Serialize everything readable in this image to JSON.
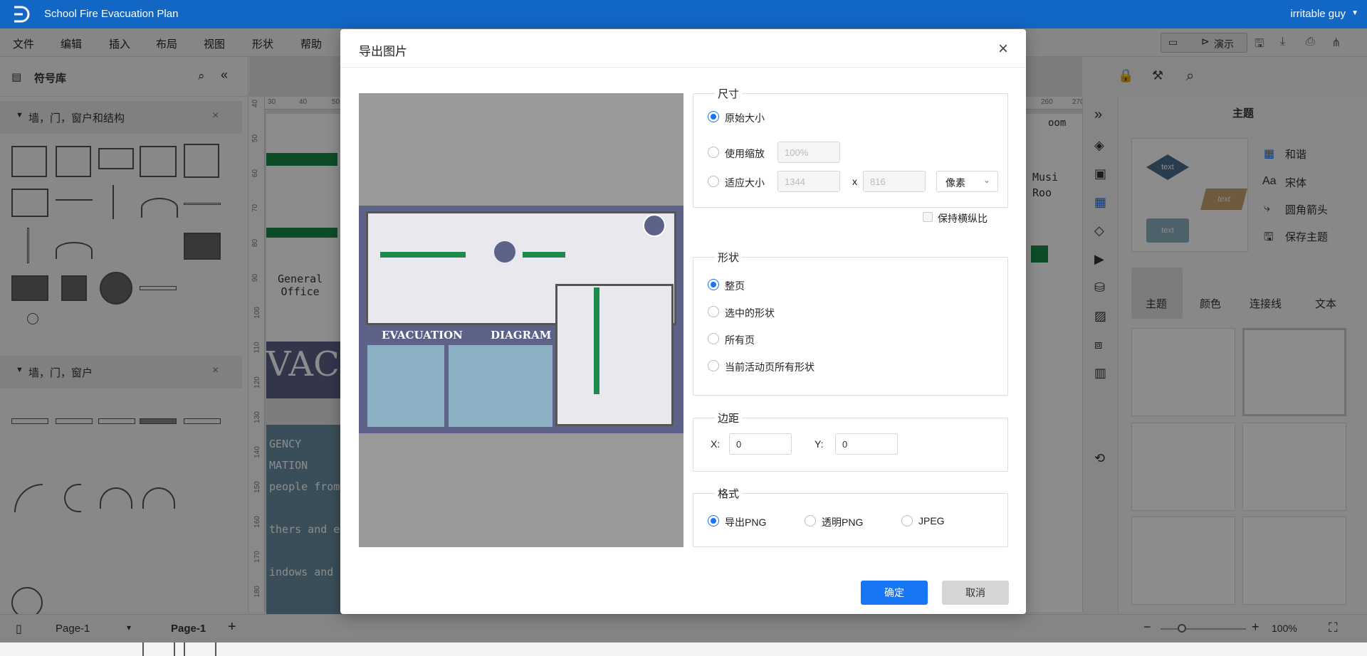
{
  "app": {
    "title": "School Fire Evacuation Plan",
    "user": "irritable guy"
  },
  "menu": [
    "文件",
    "编辑",
    "插入",
    "布局",
    "视图",
    "形状",
    "帮助"
  ],
  "topbar": {
    "present_label": "演示"
  },
  "left_panel": {
    "title": "符号库",
    "sections": [
      {
        "label": "墙，门，窗户和结构"
      },
      {
        "label": "墙，门，窗户"
      }
    ]
  },
  "canvas": {
    "ruler_h": [
      "30",
      "40",
      "50",
      "260",
      "270"
    ],
    "ruler_v": [
      "40",
      "50",
      "60",
      "70",
      "80",
      "90",
      "100",
      "110",
      "120",
      "130",
      "140",
      "150",
      "160",
      "170",
      "180"
    ],
    "labels": {
      "general_office": "General\nOffice",
      "vacu": "VACU",
      "music_room": "Musi\nRoo",
      "room": "oom"
    },
    "texts": [
      "GENCY",
      "MATION",
      "people from",
      "thers and em",
      "indows and"
    ]
  },
  "right_panel": {
    "title": "主题",
    "theme_options": [
      "和谐",
      "宋体",
      "圆角箭头",
      "保存主题"
    ],
    "tabs": [
      "主题",
      "颜色",
      "连接线",
      "文本"
    ],
    "preview_node_text": "text"
  },
  "statusbar": {
    "page_selector": "Page-1",
    "active_tab": "Page-1",
    "zoom": "100%"
  },
  "dialog": {
    "title": "导出图片",
    "preview_texts": {
      "heading_left": "EVACUATION",
      "heading_right": "DIAGRAM"
    },
    "size": {
      "title": "尺寸",
      "original": "原始大小",
      "scale": "使用缩放",
      "scale_value": "100%",
      "fit": "适应大小",
      "width": "1344",
      "times": "x",
      "height": "816",
      "unit": "像素",
      "keep_ratio": "保持横纵比"
    },
    "shape": {
      "title": "形状",
      "options": [
        "整页",
        "选中的形状",
        "所有页",
        "当前活动页所有形状"
      ]
    },
    "margin": {
      "title": "边距",
      "x_label": "X:",
      "x_value": "0",
      "y_label": "Y:",
      "y_value": "0"
    },
    "format": {
      "title": "格式",
      "options": [
        "导出PNG",
        "透明PNG",
        "JPEG"
      ]
    },
    "ok": "确定",
    "cancel": "取消"
  }
}
